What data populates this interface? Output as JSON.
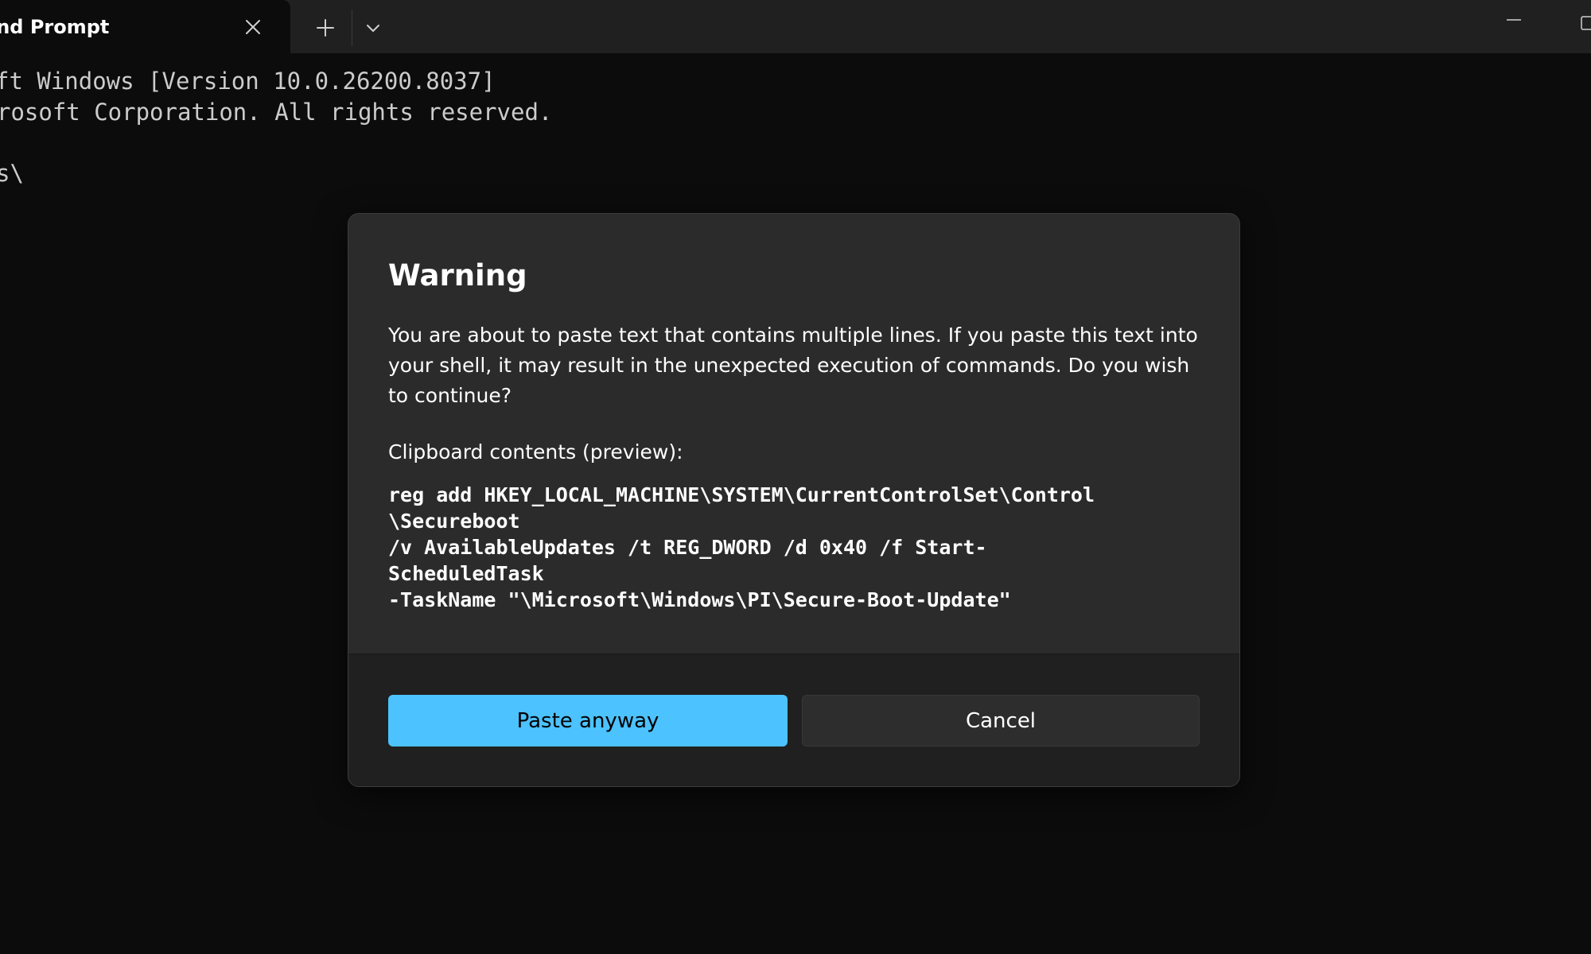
{
  "window": {
    "tab_title": "mand Prompt",
    "colors": {
      "background": "#0c0c0c",
      "tabstrip": "#202020",
      "dialog": "#2b2b2b",
      "dialog_footer": "#202020",
      "accent": "#4cc2ff"
    },
    "icons": {
      "close": "close-icon",
      "new_tab": "plus-icon",
      "dropdown": "chevron-down-icon",
      "minimize": "minimize-icon",
      "maximize": "maximize-icon"
    }
  },
  "terminal": {
    "lines": [
      "ft Windows [Version 10.0.26200.8037]",
      "rosoft Corporation. All rights reserved.",
      "s\\"
    ]
  },
  "dialog": {
    "title": "Warning",
    "message": "You are about to paste text that contains multiple lines. If you paste this text into your shell, it may result in the unexpected execution of commands. Do you wish to continue?",
    "clipboard_label": "Clipboard contents (preview):",
    "clipboard_lines": [
      "reg add HKEY_LOCAL_MACHINE\\SYSTEM\\CurrentControlSet\\Control",
      "\\Secureboot",
      "/v AvailableUpdates /t REG_DWORD /d 0x40 /f Start-",
      "ScheduledTask",
      "-TaskName \"\\Microsoft\\Windows\\PI\\Secure-Boot-Update\""
    ],
    "primary_button": "Paste anyway",
    "secondary_button": "Cancel"
  }
}
